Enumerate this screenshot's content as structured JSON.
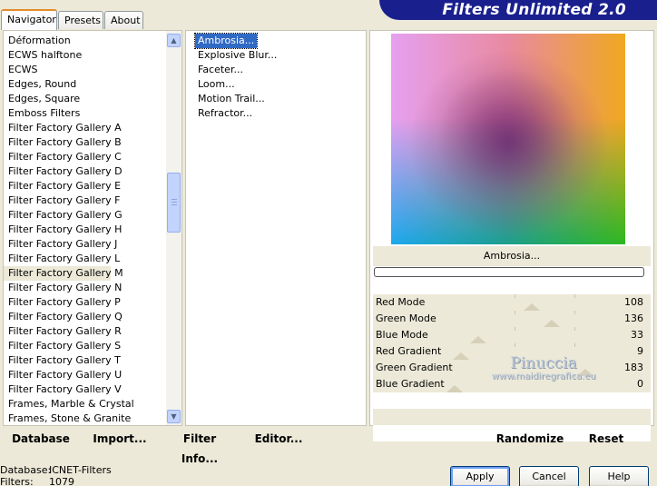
{
  "tabs": [
    "Navigator",
    "Presets",
    "About"
  ],
  "app_title": "Filters Unlimited 2.0",
  "categories": [
    "Déformation",
    "ECWS halftone",
    "ECWS",
    "Edges, Round",
    "Edges, Square",
    "Emboss Filters",
    "Filter Factory Gallery A",
    "Filter Factory Gallery B",
    "Filter Factory Gallery C",
    "Filter Factory Gallery D",
    "Filter Factory Gallery E",
    "Filter Factory Gallery F",
    "Filter Factory Gallery G",
    "Filter Factory Gallery H",
    "Filter Factory Gallery J",
    "Filter Factory Gallery L",
    "Filter Factory Gallery M",
    "Filter Factory Gallery N",
    "Filter Factory Gallery P",
    "Filter Factory Gallery Q",
    "Filter Factory Gallery R",
    "Filter Factory Gallery S",
    "Filter Factory Gallery T",
    "Filter Factory Gallery U",
    "Filter Factory Gallery V",
    "Frames, Marble & Crystal",
    "Frames, Stone & Granite"
  ],
  "selected_category": "Filter Factory Gallery M",
  "filters": [
    "Ambrosia...",
    "Explosive Blur...",
    "Faceter...",
    "Loom...",
    "Motion Trail...",
    "Refractor..."
  ],
  "selected_filter": "Ambrosia...",
  "preview_label": "Ambrosia...",
  "parameters": [
    {
      "label": "Red Mode",
      "value": "108"
    },
    {
      "label": "Green Mode",
      "value": "136"
    },
    {
      "label": "Blue Mode",
      "value": "33"
    },
    {
      "label": "Red Gradient",
      "value": "9"
    },
    {
      "label": "Green Gradient",
      "value": "183"
    },
    {
      "label": "Blue Gradient",
      "value": "0"
    }
  ],
  "parameter_max": 255,
  "watermark": {
    "line1": "Pinuccia",
    "line2": "www.maidiregrafica.eu"
  },
  "toolbar": {
    "database": "Database",
    "import": "Import...",
    "filter_info": "Filter Info...",
    "editor": "Editor...",
    "randomize": "Randomize",
    "reset": "Reset"
  },
  "status": {
    "database_label": "Database:",
    "database_value": "ICNET-Filters",
    "filters_label": "Filters:",
    "filters_value": "1079"
  },
  "buttons": {
    "apply": "Apply",
    "cancel": "Cancel",
    "help": "Help"
  },
  "colors": {
    "banner": "#1a1f8e",
    "selection": "#316ac5",
    "panel_bg": "#ece9d8"
  }
}
